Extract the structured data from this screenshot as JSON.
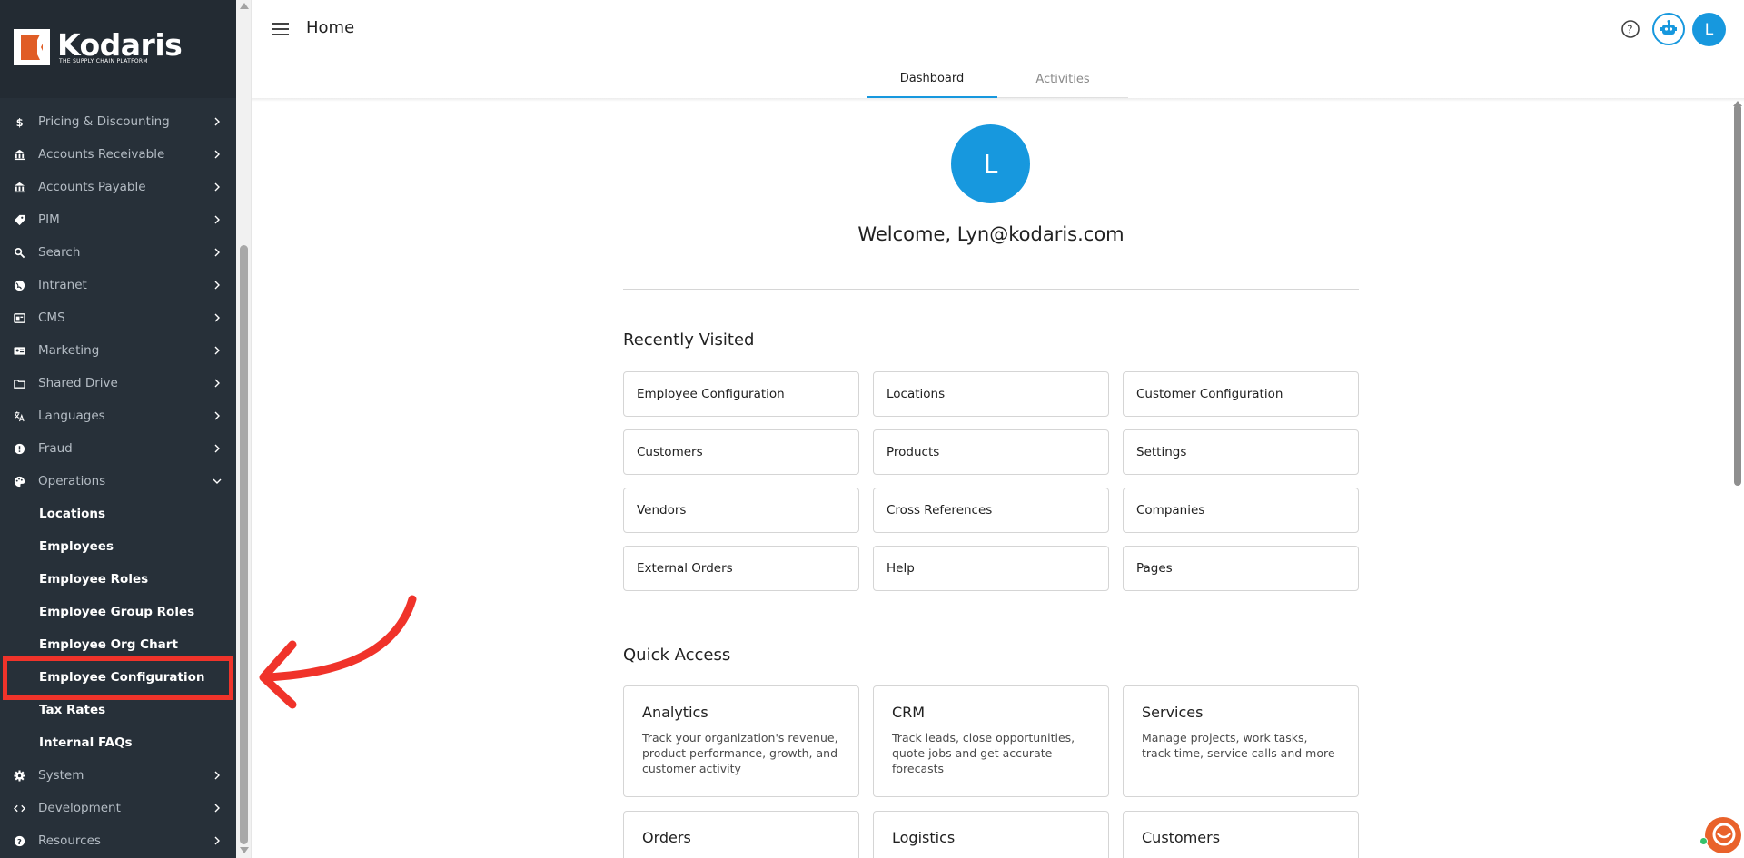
{
  "logo": {
    "name": "Kodaris",
    "tagline": "THE SUPPLY CHAIN PLATFORM"
  },
  "sidebar": {
    "items": [
      {
        "label": "Pricing & Discounting",
        "icon": "dollar-icon"
      },
      {
        "label": "Accounts Receivable",
        "icon": "bank-icon"
      },
      {
        "label": "Accounts Payable",
        "icon": "bank-icon"
      },
      {
        "label": "PIM",
        "icon": "tag-icon"
      },
      {
        "label": "Search",
        "icon": "search-icon"
      },
      {
        "label": "Intranet",
        "icon": "globe-icon"
      },
      {
        "label": "CMS",
        "icon": "cms-icon"
      },
      {
        "label": "Marketing",
        "icon": "id-card-icon"
      },
      {
        "label": "Shared Drive",
        "icon": "folder-icon"
      },
      {
        "label": "Languages",
        "icon": "translate-icon"
      },
      {
        "label": "Fraud",
        "icon": "alert-icon"
      },
      {
        "label": "Operations",
        "icon": "palette-icon",
        "expanded": true
      }
    ],
    "operations_sub": [
      "Locations",
      "Employees",
      "Employee Roles",
      "Employee Group Roles",
      "Employee Org Chart",
      "Employee Configuration",
      "Tax Rates",
      "Internal FAQs"
    ],
    "bottom_items": [
      {
        "label": "System",
        "icon": "gear-icon"
      },
      {
        "label": "Development",
        "icon": "code-icon"
      },
      {
        "label": "Resources",
        "icon": "help-circle-icon"
      }
    ]
  },
  "header": {
    "title": "Home",
    "avatar_initial": "L"
  },
  "tabs": [
    "Dashboard",
    "Activities"
  ],
  "welcome": {
    "avatar_initial": "L",
    "text": "Welcome, Lyn@kodaris.com"
  },
  "recently_visited": {
    "title": "Recently Visited",
    "items": [
      "Employee Configuration",
      "Locations",
      "Customer Configuration",
      "Customers",
      "Products",
      "Settings",
      "Vendors",
      "Cross References",
      "Companies",
      "External Orders",
      "Help",
      "Pages"
    ]
  },
  "quick_access": {
    "title": "Quick Access",
    "items": [
      {
        "title": "Analytics",
        "desc": "Track your organization's revenue, product performance, growth, and customer activity"
      },
      {
        "title": "CRM",
        "desc": "Track leads, close opportunities, quote jobs and get accurate forecasts"
      },
      {
        "title": "Services",
        "desc": "Manage projects, work tasks, track time, service calls and more"
      },
      {
        "title": "Orders",
        "desc": ""
      },
      {
        "title": "Logistics",
        "desc": ""
      },
      {
        "title": "Customers",
        "desc": ""
      }
    ]
  },
  "colors": {
    "sidebar_bg": "#273039",
    "accent": "#1798de",
    "highlight": "#f0332a"
  }
}
